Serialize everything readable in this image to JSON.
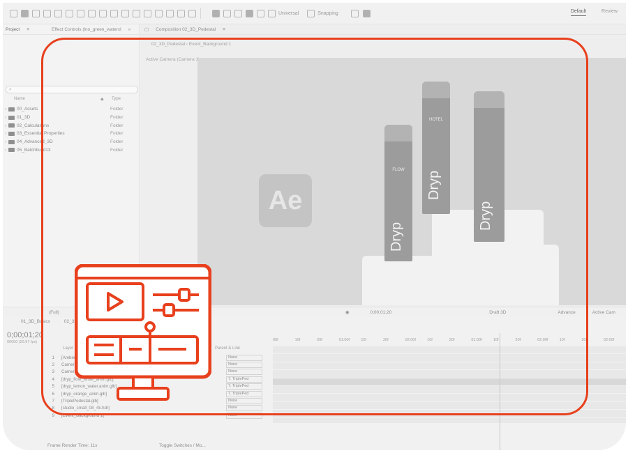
{
  "toolbar": {
    "universal": "Universal",
    "snapping": "Snapping",
    "workspaces": [
      "Default",
      "Review"
    ]
  },
  "project_panel": {
    "tabs": [
      "Project",
      "Effect Controls (lno_green_waterxl"
    ],
    "search_placeholder": "",
    "header_name": "Name",
    "header_type": "Type",
    "rows": [
      {
        "name": "00_Assets",
        "type": "Folder"
      },
      {
        "name": "01_3D",
        "type": "Folder"
      },
      {
        "name": "02_Calculations",
        "type": "Folder"
      },
      {
        "name": "03_Essential Properties",
        "type": "Folder"
      },
      {
        "name": "04_Advanced_3D",
        "type": "Folder"
      },
      {
        "name": "05_Batchbuild13",
        "type": "Folder"
      }
    ]
  },
  "composition_panel": {
    "tab": "Composition 02_3D_Pedestal",
    "breadcrumbs": [
      "02_3D_Pedestal",
      "Event_Background 1"
    ],
    "camera_label": "Active Camera (Camera 1)",
    "logo_text": "Ae",
    "bottles": [
      {
        "brand": "Dryp",
        "label": "FLOW"
      },
      {
        "brand": "Dryp",
        "label": "HOTEL"
      },
      {
        "brand": "Dryp",
        "label": ""
      }
    ]
  },
  "viewer_bar": {
    "zoom": "(Full)",
    "current_time": "0;00;01;20",
    "render": "Draft 3D",
    "advanced": "Advance",
    "active_camera": "Active Cam"
  },
  "timeline": {
    "tabs": [
      "01_3D_Basics",
      "02_3D_Pedestal"
    ],
    "timecode": "0;00;01;20",
    "fps": "00050 (29.97 fps)",
    "layer_header": "Layer Name",
    "parent_header": "Parent & Link",
    "ruler": [
      "00f",
      "10f",
      "20f",
      "01:00f",
      "10f",
      "20f",
      "02:00f",
      "10f",
      "20f",
      "01:00f",
      "10f",
      "20f",
      "02:00f",
      "10f",
      "20f",
      "02:00f"
    ],
    "layers": [
      {
        "num": "1",
        "name": "[Ambient Light 1] (1.71.mp4)",
        "parent": "None"
      },
      {
        "num": "2",
        "name": "Camera (Ambient) Light 1",
        "parent": "None"
      },
      {
        "num": "3",
        "name": "Camera 1",
        "parent": "None"
      },
      {
        "num": "4",
        "name": "[dryp_flow_white_anim.glb]",
        "parent": "7. TriplePed"
      },
      {
        "num": "5",
        "name": "[dryp_lemon_water.anim.glb]",
        "parent": "7. TriplePed"
      },
      {
        "num": "6",
        "name": "[dryp_orange_anim.glb]",
        "parent": "7. TriplePed"
      },
      {
        "num": "7",
        "name": "[TriplePedestal.glb]",
        "parent": "None"
      },
      {
        "num": "8",
        "name": "[studio_small_08_4k.hdr]",
        "parent": "None"
      },
      {
        "num": "9",
        "name": "[Event_Background 1]",
        "parent": "None"
      }
    ]
  },
  "status_bar": {
    "render_time": "Frame Render Time: 11s",
    "toggle": "Toggle Switches / Mo..."
  },
  "overlay": {
    "outline_color": "#e8401d",
    "icon": "video-editing-monitor-icon"
  }
}
